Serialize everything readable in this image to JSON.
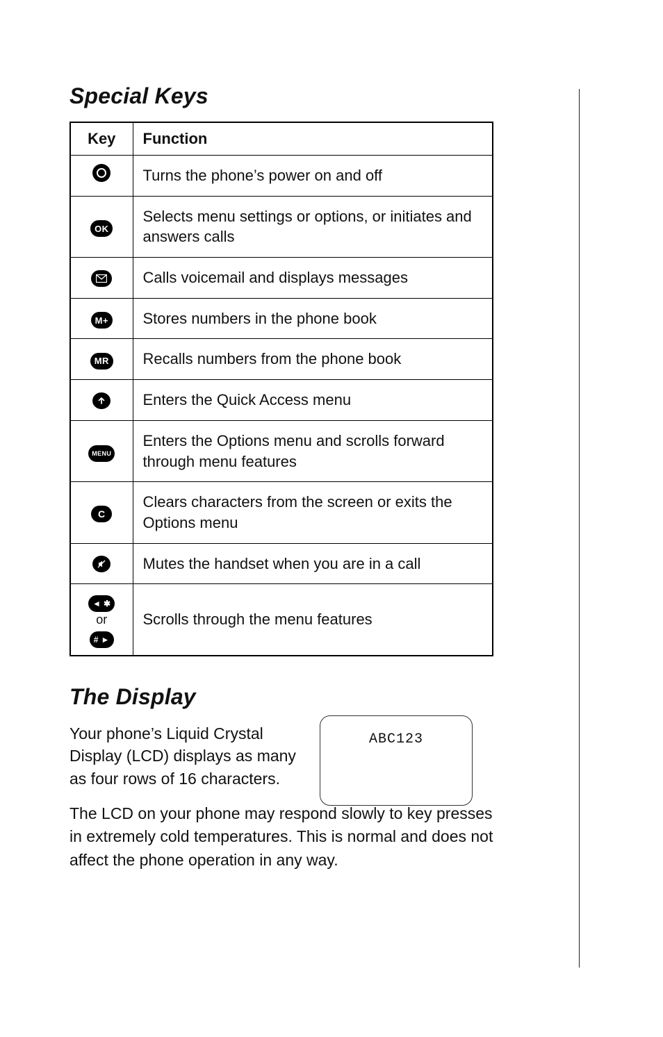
{
  "headings": {
    "special_keys": "Special Keys",
    "the_display": "The Display"
  },
  "table": {
    "head_key": "Key",
    "head_function": "Function",
    "rows": [
      {
        "icon": "power",
        "func": "Turns the phone’s power on and off"
      },
      {
        "icon": "ok",
        "func": "Selects menu settings or options, or initiates and answers calls"
      },
      {
        "icon": "mail",
        "func": "Calls voicemail and displays messages"
      },
      {
        "icon": "mplus",
        "func": "Stores numbers in the phone book"
      },
      {
        "icon": "mr",
        "func": "Recalls numbers from the phone book"
      },
      {
        "icon": "up",
        "func": "Enters the Quick Access menu"
      },
      {
        "icon": "menu",
        "func": "Enters the Options menu and scrolls forward through menu features"
      },
      {
        "icon": "c",
        "func": "Clears characters from the screen or exits the Options menu"
      },
      {
        "icon": "mute",
        "func": "Mutes the handset when you are in a call"
      },
      {
        "icon": "scroll",
        "func": "Scrolls through the menu features",
        "or": "or"
      }
    ]
  },
  "display": {
    "intro": "Your phone’s Liquid Crystal Display (LCD) displays as many as four rows of 16 characters.",
    "lcd_text": "ABC123",
    "para2": "The LCD on your phone may respond slowly to key presses in extremely cold temperatures. This is normal and does not affect the phone operation in any way."
  },
  "chart_data": {
    "type": "table",
    "columns": [
      "Key",
      "Function"
    ],
    "rows": [
      [
        "Power key",
        "Turns the phone’s power on and off"
      ],
      [
        "OK key",
        "Selects menu settings or options, or initiates and answers calls"
      ],
      [
        "Mail/Envelope key",
        "Calls voicemail and displays messages"
      ],
      [
        "M+ key",
        "Stores numbers in the phone book"
      ],
      [
        "MR key",
        "Recalls numbers from the phone book"
      ],
      [
        "Up-arrow key",
        "Enters the Quick Access menu"
      ],
      [
        "MENU key",
        "Enters the Options menu and scrolls forward through menu features"
      ],
      [
        "C key",
        "Clears characters from the screen or exits the Options menu"
      ],
      [
        "Mute key",
        "Mutes the handset when you are in a call"
      ],
      [
        "◄✱ or #► keys",
        "Scrolls through the menu features"
      ]
    ]
  }
}
